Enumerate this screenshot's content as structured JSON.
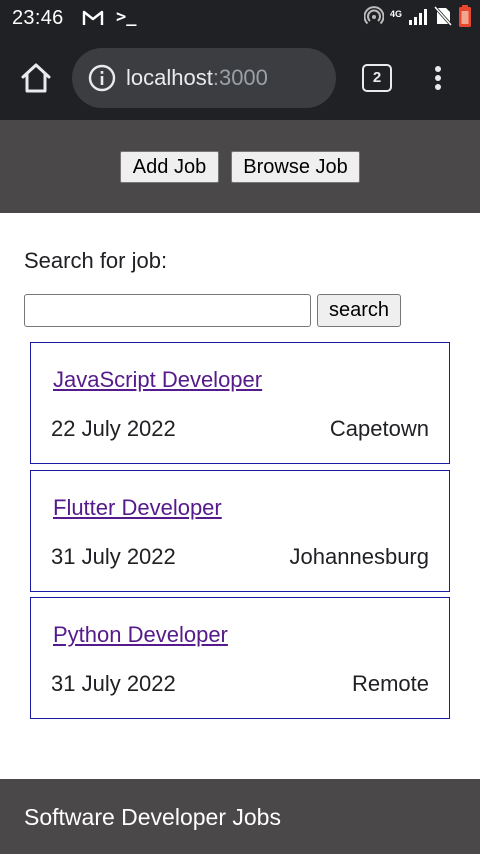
{
  "status_bar": {
    "time": "23:46",
    "network": "4G",
    "icons": [
      "gmail-icon",
      "terminal-icon",
      "hotspot-icon",
      "signal-icon",
      "no-sim-icon",
      "battery-icon"
    ]
  },
  "browser": {
    "url_host": "localhost",
    "url_port": ":3000",
    "tab_count": "2",
    "icons": [
      "home-icon",
      "info-icon",
      "tabs-icon",
      "more-vert-icon"
    ]
  },
  "header": {
    "add_job_label": "Add Job",
    "browse_job_label": "Browse Job"
  },
  "search": {
    "label": "Search for job:",
    "value": "",
    "button_label": "search"
  },
  "jobs": [
    {
      "title": "JavaScript Developer",
      "date": "22 July 2022",
      "location": "Capetown"
    },
    {
      "title": "Flutter Developer",
      "date": "31 July 2022",
      "location": "Johannesburg"
    },
    {
      "title": "Python Developer",
      "date": "31 July 2022",
      "location": "Remote"
    }
  ],
  "footer": {
    "text": "Software Developer Jobs"
  },
  "colors": {
    "browser_chrome": "#202124",
    "app_bar": "#4a4849",
    "link": "#551a8b",
    "card_border": "#1a1aa6"
  }
}
